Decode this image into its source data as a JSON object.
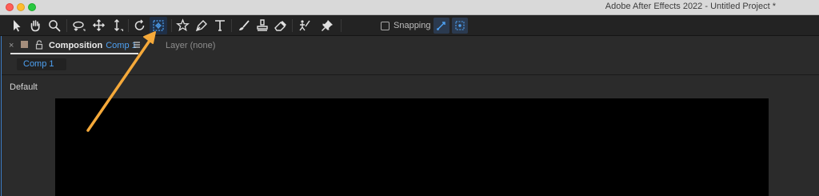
{
  "window": {
    "app_title": "Adobe After Effects 2022 - Untitled Project *"
  },
  "toolbar": {
    "tools": [
      {
        "name": "selection-tool",
        "icon": "arrow-icon"
      },
      {
        "name": "hand-tool",
        "icon": "hand-icon"
      },
      {
        "name": "zoom-tool",
        "icon": "magnifier-icon"
      },
      {
        "name": "orbit-camera-tool",
        "icon": "orbit-icon"
      },
      {
        "name": "pan-camera-tool",
        "icon": "move-icon"
      },
      {
        "name": "dolly-camera-tool",
        "icon": "dolly-icon"
      },
      {
        "name": "rotation-tool",
        "icon": "rotate-icon"
      },
      {
        "name": "pan-behind-tool",
        "icon": "anchor-point-icon",
        "active": true
      },
      {
        "name": "shape-tool",
        "icon": "star-icon"
      },
      {
        "name": "pen-tool",
        "icon": "pen-icon"
      },
      {
        "name": "type-tool",
        "icon": "text-icon"
      },
      {
        "name": "brush-tool",
        "icon": "brush-icon"
      },
      {
        "name": "clone-stamp-tool",
        "icon": "stamp-icon"
      },
      {
        "name": "eraser-tool",
        "icon": "eraser-icon"
      },
      {
        "name": "roto-brush-tool",
        "icon": "roto-icon"
      },
      {
        "name": "puppet-pin-tool",
        "icon": "pin-icon"
      }
    ],
    "snapping_label": "Snapping",
    "snapping_checked": false
  },
  "panel": {
    "tab_label": "Composition",
    "tab_comp_name": "Comp 1",
    "layer_tab": "Layer (none)",
    "close_glyph": "×",
    "comp_chip": "Comp 1",
    "view_label": "Default"
  },
  "annotation": {
    "arrow_color": "#f5a93a",
    "points_to": "pan-behind-tool"
  },
  "colors": {
    "accent_blue": "#4ea1f3",
    "panel_bg": "#2b2b2b",
    "canvas_bg": "#000000"
  }
}
